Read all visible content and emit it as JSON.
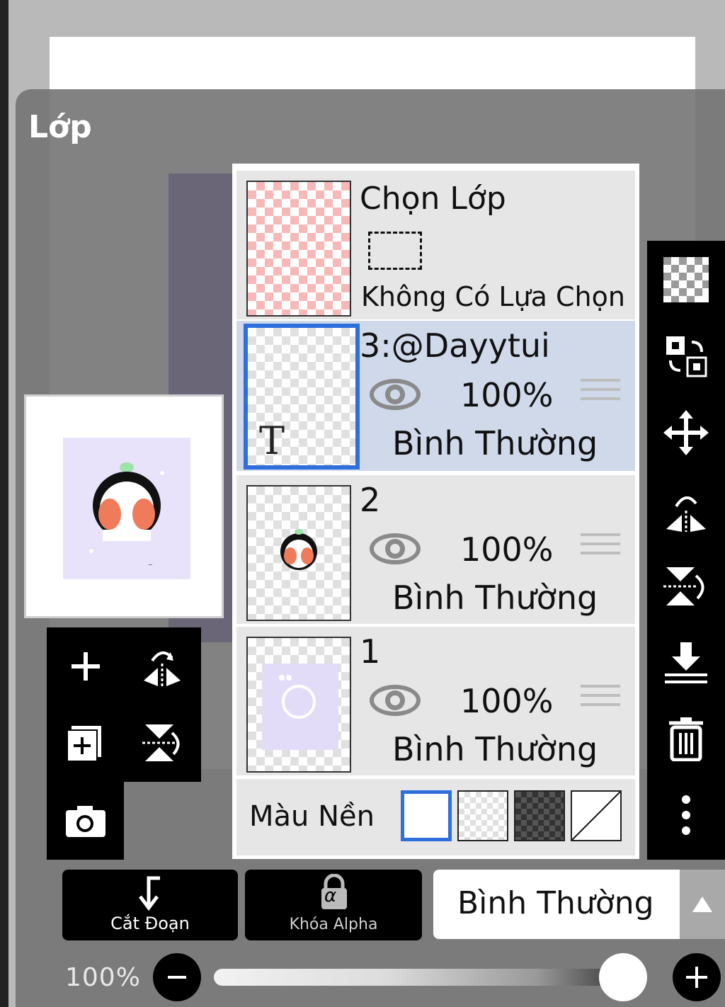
{
  "panel": {
    "title": "Lớp"
  },
  "selection_layer": {
    "title": "Chọn Lớp",
    "status": "Không Có Lựa Chọn"
  },
  "layers": [
    {
      "name": "3:@Dayytui",
      "opacity": "100%",
      "blend": "Bình Thường",
      "selected": true,
      "type_glyph": "T"
    },
    {
      "name": "2",
      "opacity": "100%",
      "blend": "Bình Thường",
      "selected": false
    },
    {
      "name": "1",
      "opacity": "100%",
      "blend": "Bình Thường",
      "selected": false
    }
  ],
  "background": {
    "label": "Màu Nền",
    "options": [
      "white",
      "checker-light",
      "checker-dark",
      "none"
    ],
    "selected": "white"
  },
  "bottom": {
    "clip_label": "Cắt Đoạn",
    "alpha_lock_label": "Khóa Alpha",
    "alpha_glyph": "α",
    "blend_mode": "Bình Thường"
  },
  "opacity_slider": {
    "label": "100%",
    "value": 1.0
  },
  "icons": {
    "left": [
      "add-layer-icon",
      "flip-horizontal-icon",
      "add-layer-copy-icon",
      "flip-vertical-icon",
      "camera-icon"
    ],
    "right": [
      "transparency-icon",
      "swap-layer-icon",
      "move-icon",
      "flip-h-icon",
      "flip-v-icon",
      "merge-down-icon",
      "delete-icon",
      "more-icon"
    ]
  },
  "colors": {
    "accent": "#2f6fdd",
    "selected_row": "#cfd9ea",
    "panel": "#7b7b7b"
  }
}
